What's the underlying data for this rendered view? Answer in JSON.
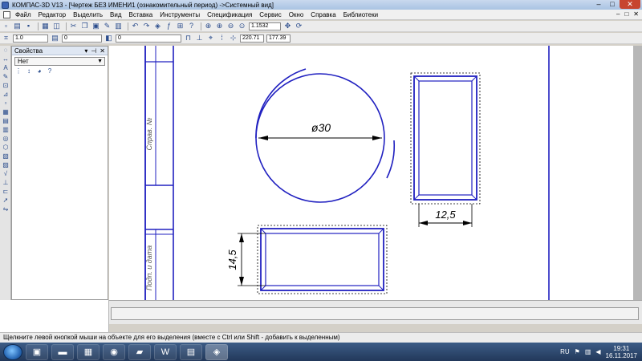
{
  "window": {
    "title": "КОМПАС-3D V13 - [Чертеж БЕЗ ИМЕНИ1 (ознакомительный период) ->Системный вид]",
    "controls": {
      "minimize": "–",
      "maximize": "□",
      "close": "✕"
    }
  },
  "menu": {
    "items": [
      "Файл",
      "Редактор",
      "Выделить",
      "Вид",
      "Вставка",
      "Инструменты",
      "Спецификация",
      "Сервис",
      "Окно",
      "Справка",
      "Библиотеки"
    ],
    "doc_controls": [
      "–",
      "□",
      "✕"
    ]
  },
  "toolbar1": {
    "zoom_value": "1.1532"
  },
  "toolbar2": {
    "line_scale": "1.0",
    "layer_state": "0",
    "layer_number": "0",
    "coord_x": "220.71",
    "coord_y": "177.39"
  },
  "properties_panel": {
    "title": "Свойства",
    "select_value": "Нет"
  },
  "drawing": {
    "circle_dim": "ø30",
    "rect_vertical_dim": "12,5",
    "rect_horizontal_dim": "14,5",
    "stamp_label_top": "Справ. №",
    "stamp_label_bottom": "Подп. и дата",
    "line_color": "#2020c0",
    "sheet_color": "#ffffff"
  },
  "status": {
    "hint": "Щелкните левой кнопкой мыши на объекте для его выделения (вместе с Ctrl или Shift - добавить к выделенным)"
  },
  "taskbar": {
    "apps": [
      "explorer-icon",
      "cmd-icon",
      "calculator-icon",
      "chrome-icon",
      "folder-icon",
      "word-icon",
      "notes-icon",
      "kompas-icon"
    ],
    "language": "RU",
    "time": "19:31",
    "date": "16.11.2017"
  }
}
